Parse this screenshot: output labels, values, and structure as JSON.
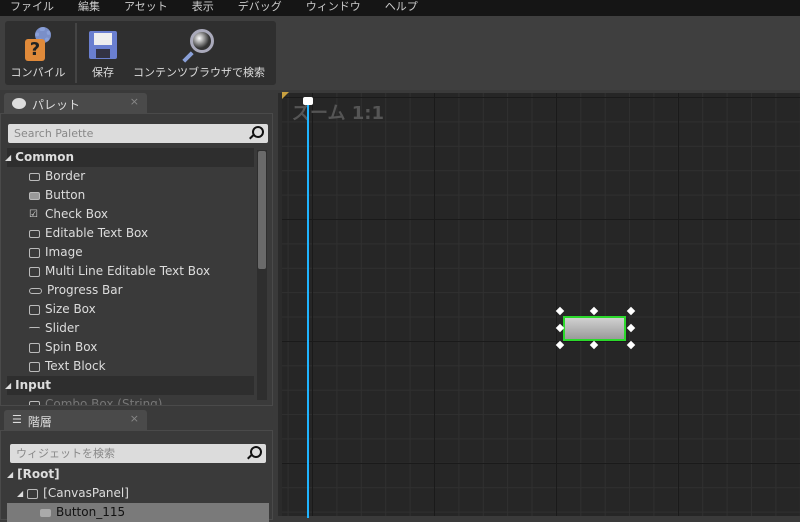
{
  "menu": [
    "ファイル",
    "編集",
    "アセット",
    "表示",
    "デバッグ",
    "ウィンドウ",
    "ヘルプ"
  ],
  "toolbar": {
    "compile": "コンパイル",
    "save": "保存",
    "browse": "コンテンツブラウザで検索"
  },
  "palette": {
    "tab": "パレット",
    "close": "×",
    "search_placeholder": "Search Palette",
    "groups": [
      {
        "label": "Common",
        "items": [
          "Border",
          "Button",
          "Check Box",
          "Editable Text Box",
          "Image",
          "Multi Line Editable Text Box",
          "Progress Bar",
          "Size Box",
          "Slider",
          "Spin Box",
          "Text Block"
        ]
      },
      {
        "label": "Input",
        "items": [
          "Combo Box (String)"
        ]
      }
    ]
  },
  "hierarchy": {
    "tab": "階層",
    "close": "×",
    "search_placeholder": "ウィジェットを検索",
    "items": [
      "[Root]",
      "[CanvasPanel]",
      "Button_115"
    ]
  },
  "designer": {
    "zoom_label": "ズーム 1:1",
    "selection_color": "#2bd92b",
    "ruler_color": "#1fb4ff"
  }
}
